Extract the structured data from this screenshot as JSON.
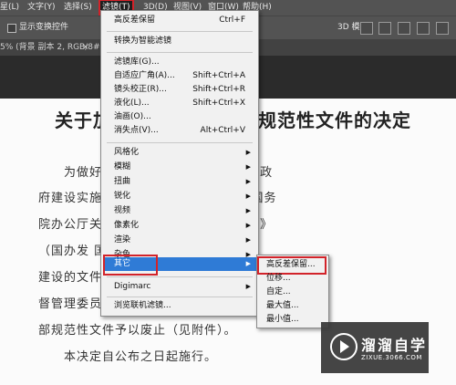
{
  "menubar": {
    "items": [
      "星(L)",
      "文字(Y)",
      "选择(S)",
      "滤镜(T)",
      "3D(D)",
      "视图(V)",
      "窗口(W)",
      "帮助(H)"
    ]
  },
  "options": {
    "checkbox_label": "显示变换控件",
    "mode_3d": "3D 模式:"
  },
  "tab": {
    "title": "5% (背景 副本 2, RGB/8#) *",
    "close": "×"
  },
  "document": {
    "title_left": "关于加",
    "title_right": "规范性文件的决定",
    "lines": [
      "为做好                  贯彻落实工作，按照《法治政",
      "府建设实施                中发〔2015〕36 号)、《国务",
      "院办公厅关                制定和监督管理工作的通知》",
      "（国办发                    国务院关于推进法治政府",
      "建设的文件                 需要，中国证券监",
      "督管理委员                 了清理，决定对 18",
      "部规范性文件予以废止（见附件）。",
      "本决定自公布之日起施行。"
    ]
  },
  "filter_menu": {
    "items": [
      {
        "label": "高反差保留",
        "shortcut": "Ctrl+F"
      },
      {
        "label": "转换为智能滤镜"
      },
      {
        "label": "滤镜库(G)..."
      },
      {
        "label": "自适应广角(A)...",
        "shortcut": "Shift+Ctrl+A"
      },
      {
        "label": "镜头校正(R)...",
        "shortcut": "Shift+Ctrl+R"
      },
      {
        "label": "液化(L)...",
        "shortcut": "Shift+Ctrl+X"
      },
      {
        "label": "油画(O)..."
      },
      {
        "label": "消失点(V)...",
        "shortcut": "Alt+Ctrl+V"
      },
      {
        "label": "风格化"
      },
      {
        "label": "模糊"
      },
      {
        "label": "扭曲"
      },
      {
        "label": "锐化"
      },
      {
        "label": "视频"
      },
      {
        "label": "像素化"
      },
      {
        "label": "渲染"
      },
      {
        "label": "杂色"
      },
      {
        "label": "其它"
      },
      {
        "label": "Digimarc"
      },
      {
        "label": "浏览联机滤镜..."
      }
    ],
    "arrow": "▶"
  },
  "other_submenu": {
    "items": [
      "高反差保留...",
      "位移...",
      "自定...",
      "最大值...",
      "最小值..."
    ]
  },
  "watermark": {
    "name": "溜溜自学",
    "url": "ZIXUE.3066.COM"
  },
  "colors": {
    "highlight": "#2f7bd6",
    "annotation_red": "#d2232a"
  }
}
